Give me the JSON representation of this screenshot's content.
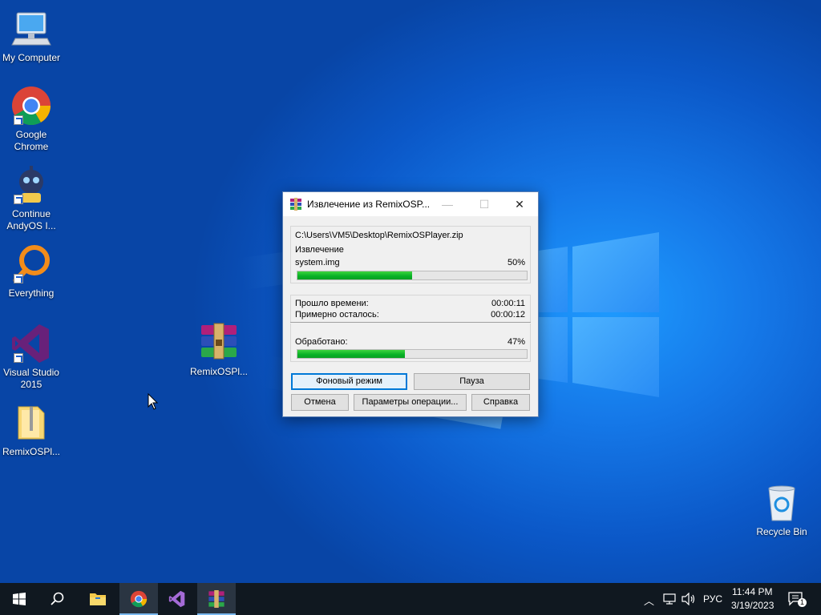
{
  "desktop": {
    "icons": [
      {
        "label": "My Computer",
        "icon": "computer-icon"
      },
      {
        "label": "Google Chrome",
        "icon": "chrome-icon"
      },
      {
        "label": "Continue AndyOS I...",
        "icon": "andy-icon"
      },
      {
        "label": "Everything",
        "icon": "everything-search-icon"
      },
      {
        "label": "Visual Studio 2015",
        "icon": "visual-studio-icon"
      },
      {
        "label": "RemixOSPl...",
        "icon": "folder-icon"
      },
      {
        "label": "RemixOSPl...",
        "icon": "winrar-archive-icon"
      },
      {
        "label": "Recycle Bin",
        "icon": "recycle-bin-icon"
      }
    ]
  },
  "dialog": {
    "title": "Извлечение из RemixOSP...",
    "archive_path": "C:\\Users\\VM5\\Desktop\\RemixOSPlayer.zip",
    "operation_label": "Извлечение",
    "current_file": "system.img",
    "file_percent_text": "50%",
    "file_progress": 0.5,
    "elapsed_label": "Прошло времени:",
    "elapsed_value": "00:00:11",
    "remaining_label": "Примерно осталось:",
    "remaining_value": "00:00:12",
    "processed_label": "Обработано:",
    "processed_percent_text": "47%",
    "processed_progress": 0.47,
    "buttons": {
      "background": "Фоновый режим",
      "pause": "Пауза",
      "cancel": "Отмена",
      "options": "Параметры операции...",
      "help": "Справка"
    }
  },
  "taskbar": {
    "apps": [
      "start-icon",
      "search-icon",
      "file-explorer-icon",
      "chrome-icon",
      "visual-studio-icon",
      "winrar-icon"
    ],
    "language": "РУС",
    "time": "11:44 PM",
    "date": "3/19/2023",
    "notification_count": "1"
  },
  "colors": {
    "accent": "#0078d7",
    "progress": "#06b025",
    "desktop": "#0b58c8",
    "taskbar": "#101820"
  }
}
